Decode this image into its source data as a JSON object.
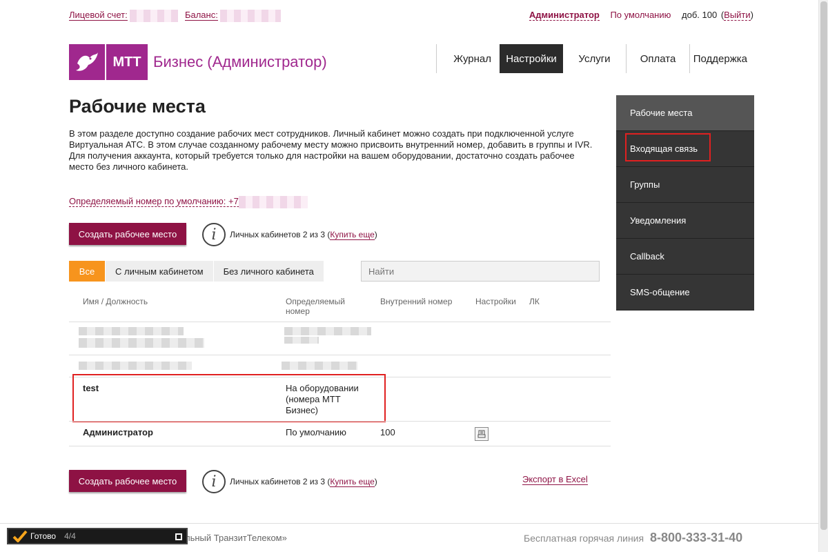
{
  "topbar": {
    "account_label": "Лицевой счет:",
    "balance_label": "Баланс:",
    "user": "Администратор",
    "profile": "По умолчанию",
    "ext": "доб. 100",
    "logout_open": "(",
    "logout": "Выйти",
    "logout_close": ")"
  },
  "brand": {
    "logo_text": "МТТ",
    "title": "Бизнес (Администратор)",
    "color": "#a0288e"
  },
  "nav": [
    "Журнал",
    "Настройки",
    "Услуги",
    "Оплата",
    "Поддержка"
  ],
  "page": {
    "title": "Рабочие места",
    "desc1": "В этом разделе доступно создание рабочих мест сотрудников. Личный кабинет можно создать при подключенной услуге Виртуальная АТС. В этом случае созданному рабочему месту можно присвоить внутренний номер, добавить в группы и IVR.",
    "desc2": "Для получения аккаунта, который требуется только для настройки на вашем оборудовании, достаточно создать рабочее место без личного кабинета.",
    "default_number_label": "Определяемый номер по умолчанию: +7"
  },
  "actions": {
    "create_button": "Создать рабочее место",
    "cabinets_text": "Личных кабинетов 2 из 3 (",
    "buy_more": "Купить еще",
    "cabinets_close": ")",
    "export": "Экспорт в Excel"
  },
  "tabs": [
    "Все",
    "С личным кабинетом",
    "Без личного кабинета"
  ],
  "search": {
    "placeholder": "Найти"
  },
  "table": {
    "headers": {
      "name": "Имя / Должность",
      "number_1": "Определяемый",
      "number_2": "номер",
      "internal": "Внутренний номер",
      "settings": "Настройки",
      "lk": "ЛК"
    },
    "rows": [
      {
        "name": "test",
        "number_1": "На оборудовании",
        "number_2": "(номера МТТ",
        "number_3": "Бизнес)",
        "internal": ""
      },
      {
        "name": "Администратор",
        "number_1": "По умолчанию",
        "internal": "100"
      }
    ]
  },
  "sidebar": [
    "Рабочие места",
    "Входящая связь",
    "Группы",
    "Уведомления",
    "Callback",
    "SMS-общение"
  ],
  "footer": {
    "copyright": "льный ТранзитТелеком»",
    "hotline_label": "Бесплатная горячая линия",
    "phone": "8-800-333-31-40"
  },
  "statusbar": {
    "text": "Готово",
    "count": "4/4"
  }
}
